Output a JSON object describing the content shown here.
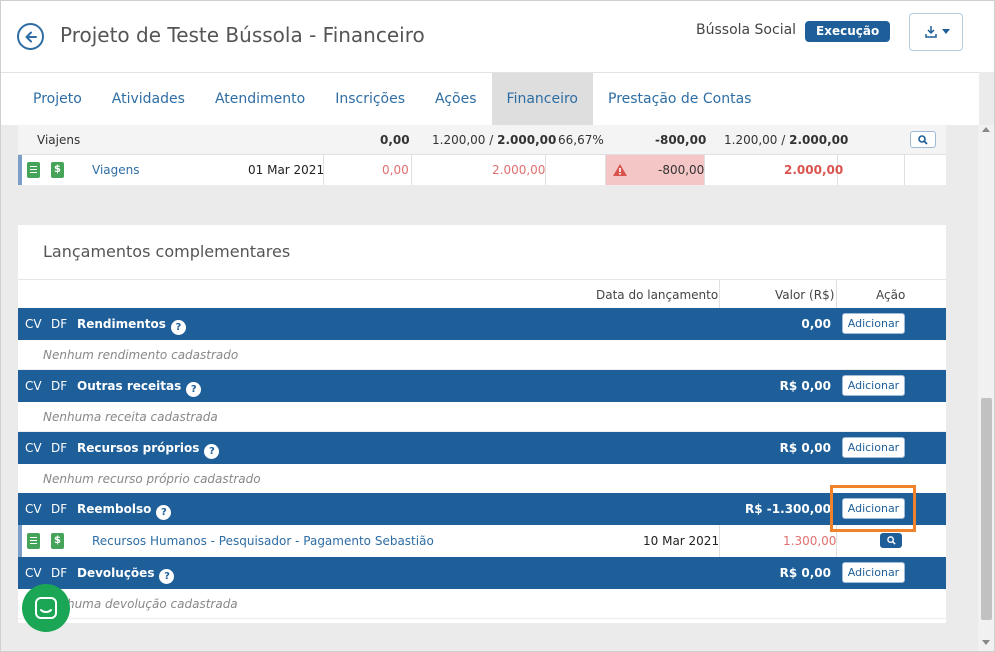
{
  "header": {
    "title": "Projeto de Teste Bússola - Financeiro",
    "org": "Bússola Social",
    "status": "Execução"
  },
  "tabs": [
    "Projeto",
    "Atividades",
    "Atendimento",
    "Inscrições",
    "Ações",
    "Financeiro",
    "Prestação de Contas"
  ],
  "active_tab": "Financeiro",
  "top_table": {
    "summary": {
      "label": "Viajens",
      "c1": "0,00",
      "c2a": "1.200,00 / ",
      "c2b": "2.000,00",
      "c3": "66,67%",
      "c4": "-800,00",
      "c5a": "1.200,00 / ",
      "c5b": "2.000,00"
    },
    "item": {
      "name": "Viagens",
      "date": "01 Mar 2021",
      "v1": "0,00",
      "v2": "2.000,00",
      "v3": "-800,00",
      "v4": "2.000,00"
    }
  },
  "complementary": {
    "title": "Lançamentos complementares",
    "headers": {
      "date": "Data do lançamento",
      "value": "Valor (R$)",
      "action": "Ação"
    },
    "cv": "CV",
    "df": "DF",
    "add_label": "Adicionar",
    "sections": [
      {
        "name": "Rendimentos",
        "value": "0,00",
        "empty": "Nenhum rendimento cadastrado"
      },
      {
        "name": "Outras receitas",
        "value": "R$ 0,00",
        "empty": "Nenhuma receita cadastrada"
      },
      {
        "name": "Recursos próprios",
        "value": "R$ 0,00",
        "empty": "Nenhum recurso próprio cadastrado"
      },
      {
        "name": "Reembolso",
        "value": "R$ -1.300,00",
        "empty": ""
      },
      {
        "name": "Devoluções",
        "value": "R$ 0,00",
        "empty": "Nenhuma devolução cadastrada"
      }
    ],
    "reimbursement_item": {
      "name": "Recursos Humanos - Pesquisador - Pagamento Sebastião",
      "date": "10 Mar 2021",
      "value": "1.300,00"
    }
  },
  "colors": {
    "primary": "#1e5f99",
    "danger_bg": "#f5c6c6",
    "highlight": "#f0822b",
    "chat": "#1aa654"
  }
}
